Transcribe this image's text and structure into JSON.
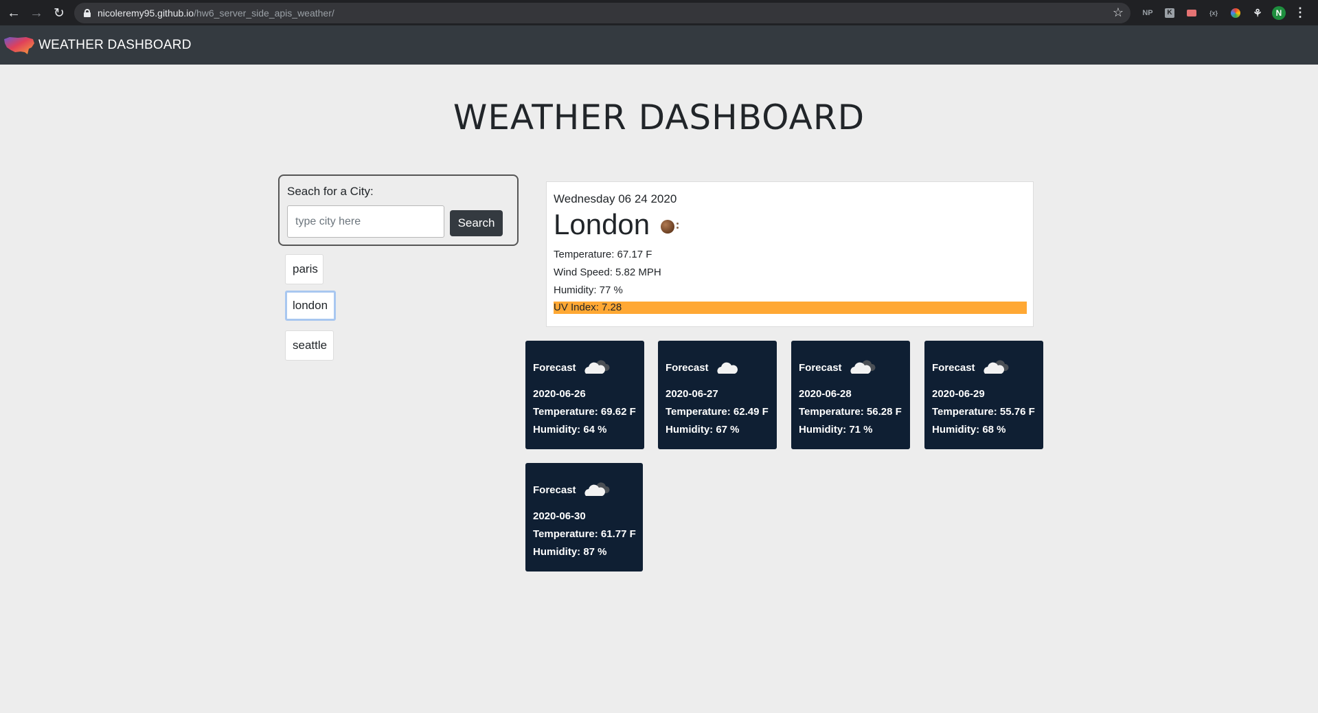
{
  "browser": {
    "url_host": "nicoleremy95.github.io",
    "url_path": "/hw6_server_side_apis_weather/",
    "extensions": [
      "NP",
      "K",
      "",
      "{x}",
      "",
      ""
    ],
    "profile_initial": "N"
  },
  "navbar": {
    "brand": "WEATHER DASHBOARD"
  },
  "page": {
    "title": "WEATHER DASHBOARD"
  },
  "search": {
    "label": "Seach for a City:",
    "placeholder": "type city here",
    "value": "",
    "button_label": "Search"
  },
  "history": [
    "paris",
    "london",
    "seattle"
  ],
  "current": {
    "date": "Wednesday 06 24 2020",
    "city": "London",
    "temperature": "Temperature: 67.17 F",
    "wind": "Wind Speed: 5.82 MPH",
    "humidity": "Humidity: 77 %",
    "uv": "UV Index: 7.28",
    "uv_color": "#ffa834"
  },
  "forecast": [
    {
      "label": "Forecast",
      "date": "2020-06-26",
      "temperature": "Temperature: 69.62 F",
      "humidity": "Humidity: 64 %",
      "icon": "cloudy-icon"
    },
    {
      "label": "Forecast",
      "date": "2020-06-27",
      "temperature": "Temperature: 62.49 F",
      "humidity": "Humidity: 67 %",
      "icon": "cloud-icon"
    },
    {
      "label": "Forecast",
      "date": "2020-06-28",
      "temperature": "Temperature: 56.28 F",
      "humidity": "Humidity: 71 %",
      "icon": "cloudy-icon"
    },
    {
      "label": "Forecast",
      "date": "2020-06-29",
      "temperature": "Temperature: 55.76 F",
      "humidity": "Humidity: 68 %",
      "icon": "cloudy-icon"
    },
    {
      "label": "Forecast",
      "date": "2020-06-30",
      "temperature": "Temperature: 61.77 F",
      "humidity": "Humidity: 87 %",
      "icon": "cloudy-icon"
    }
  ],
  "colors": {
    "navbar": "#343a40",
    "forecast_bg": "#0f1f33",
    "page_bg": "#ededed"
  }
}
